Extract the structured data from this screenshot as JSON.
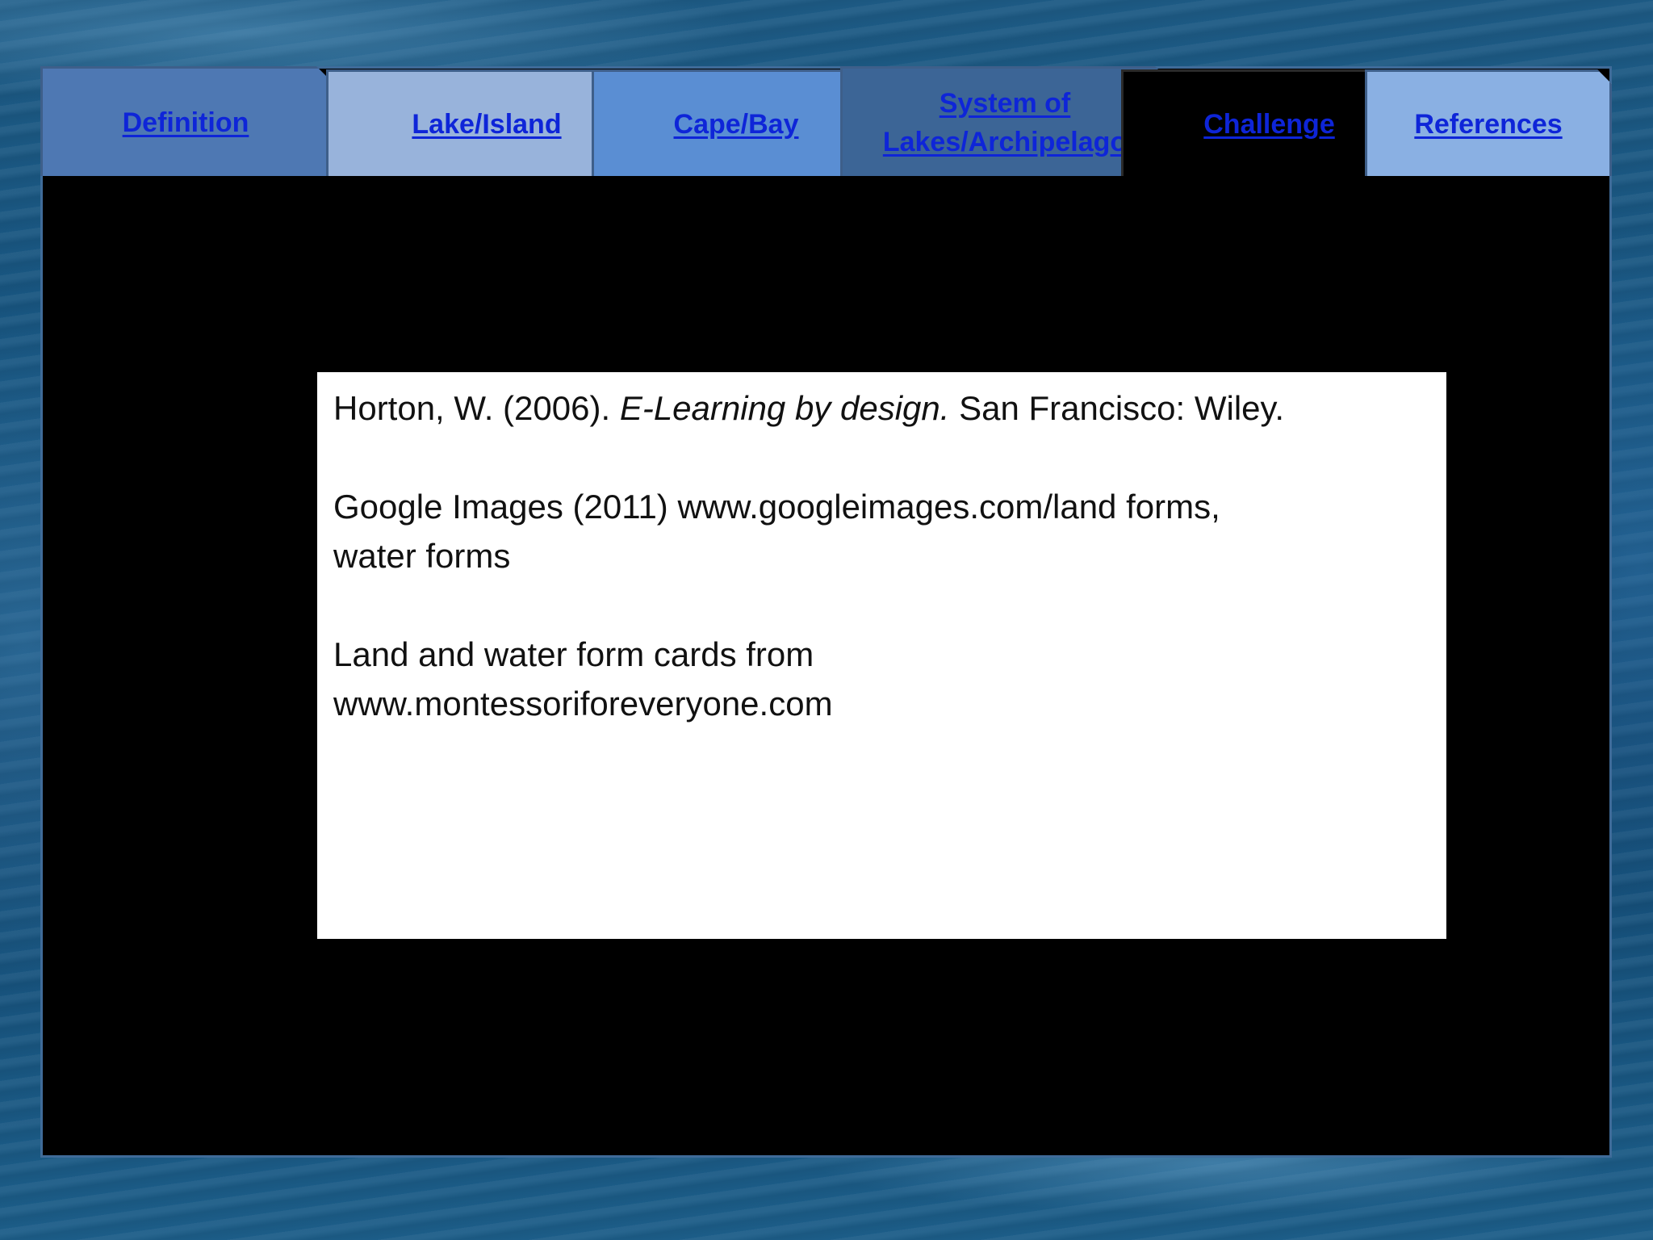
{
  "tabs": [
    {
      "label": "Definition",
      "bg": "#4e78b3"
    },
    {
      "label": "Lake/Island",
      "bg": "#98b3db"
    },
    {
      "label": "Cape/Bay",
      "bg": "#5a8ed3"
    },
    {
      "label": "System of",
      "label2": "Lakes/Archipelago",
      "bg": "#3c6596"
    },
    {
      "label": "Challenge",
      "bg": "#000000"
    },
    {
      "label": "References",
      "bg": "#8ab0e3"
    }
  ],
  "references": [
    {
      "author": "Horton, W. (2006). ",
      "title": "E-Learning by design.",
      "rest": " San Francisco: Wiley."
    },
    {
      "line1": "Google Images (2011) www.googleimages.com/land forms,",
      "line2": "water forms"
    },
    {
      "line1": "Land and water form cards from",
      "line2": "www.montessoriforeveryone.com"
    }
  ]
}
